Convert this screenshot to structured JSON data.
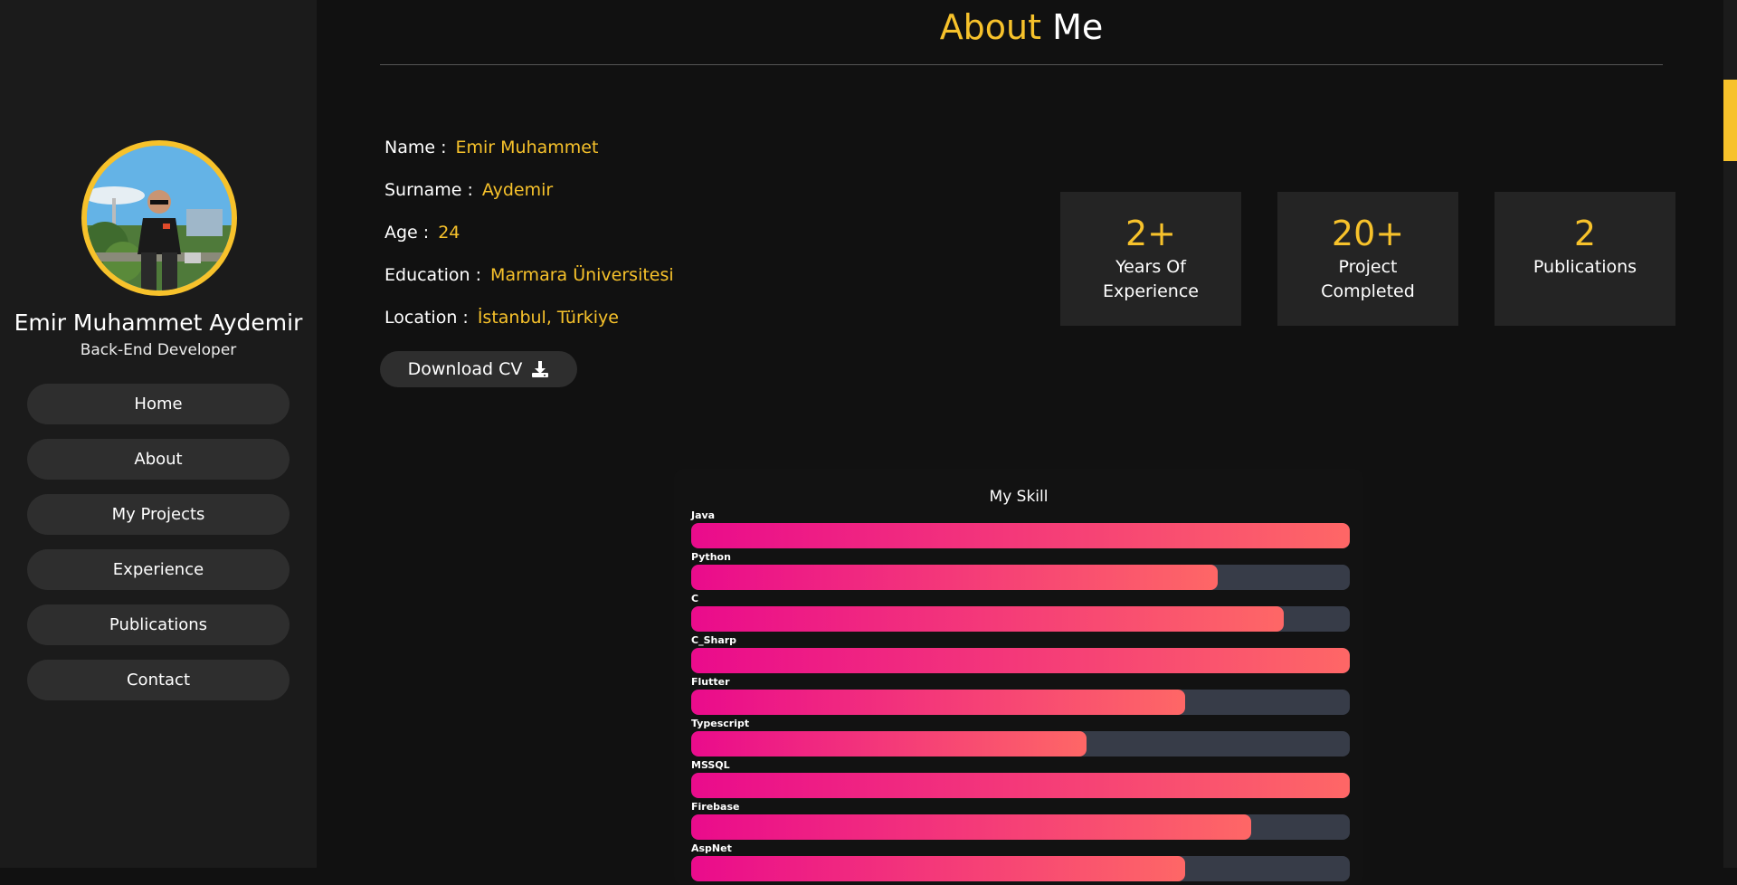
{
  "sidebar": {
    "name": "Emir Muhammet Aydemir",
    "role": "Back-End Developer",
    "nav": [
      {
        "label": "Home"
      },
      {
        "label": "About"
      },
      {
        "label": "My Projects"
      },
      {
        "label": "Experience"
      },
      {
        "label": "Publications"
      },
      {
        "label": "Contact"
      }
    ]
  },
  "header": {
    "title_accent": "About",
    "title_rest": "Me"
  },
  "info": [
    {
      "label": "Name :",
      "value": "Emir Muhammet"
    },
    {
      "label": "Surname :",
      "value": "Aydemir"
    },
    {
      "label": "Age :",
      "value": "24"
    },
    {
      "label": "Education :",
      "value": "Marmara Üniversitesi"
    },
    {
      "label": "Location :",
      "value": "İstanbul, Türkiye"
    }
  ],
  "download_cv": {
    "label": "Download CV",
    "icon": "download-icon"
  },
  "stats": [
    {
      "value": "2+",
      "label_line1": "Years Of",
      "label_line2": "Experience"
    },
    {
      "value": "20+",
      "label_line1": "Project",
      "label_line2": "Completed"
    },
    {
      "value": "2",
      "label_line1": "Publications",
      "label_line2": ""
    }
  ],
  "skills": {
    "title": "My Skill",
    "items": [
      {
        "name": "Java",
        "level": 1.0
      },
      {
        "name": "Python",
        "level": 0.8
      },
      {
        "name": "C",
        "level": 0.9
      },
      {
        "name": "C_Sharp",
        "level": 1.0
      },
      {
        "name": "Flutter",
        "level": 0.75
      },
      {
        "name": "Typescript",
        "level": 0.6
      },
      {
        "name": "MSSQL",
        "level": 1.0
      },
      {
        "name": "Firebase",
        "level": 0.85
      },
      {
        "name": "AspNet",
        "level": 0.75
      }
    ]
  },
  "colors": {
    "accent": "#f7c22b",
    "bar_start": "#ea0b8c",
    "bar_end": "#fe6766",
    "track": "#373c48"
  }
}
